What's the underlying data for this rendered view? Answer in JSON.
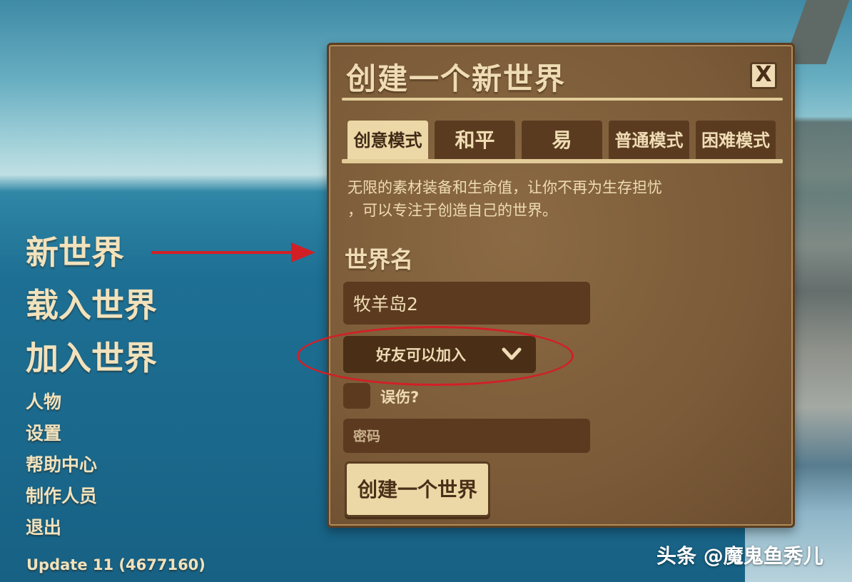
{
  "menu": {
    "items": [
      {
        "label": "新世界"
      },
      {
        "label": "载入世界"
      },
      {
        "label": "加入世界"
      },
      {
        "label": "人物"
      },
      {
        "label": "设置"
      },
      {
        "label": "帮助中心"
      },
      {
        "label": "制作人员"
      },
      {
        "label": "退出"
      }
    ],
    "version": "Update 11 (4677160)"
  },
  "dialog": {
    "title": "创建一个新世界",
    "close_label": "X",
    "tabs": [
      {
        "label": "创意模式",
        "active": true
      },
      {
        "label": "和平"
      },
      {
        "label": "易"
      },
      {
        "label": "普通模式"
      },
      {
        "label": "困难模式"
      }
    ],
    "description_line1": "无限的素材装备和生命值，让你不再为生存担忧",
    "description_line2": "，可以专注于创造自己的世界。",
    "world_name_label": "世界名",
    "world_name_value": "牧羊岛2",
    "join_dropdown": "好友可以加入",
    "friendly_fire_label": "误伤?",
    "friendly_fire_checked": false,
    "password_placeholder": "密码",
    "create_button": "创建一个世界"
  },
  "annotations": {
    "arrow_color": "#d21f26",
    "circle_color": "#d21f26"
  },
  "watermark": "头条 @魔鬼鱼秀儿"
}
